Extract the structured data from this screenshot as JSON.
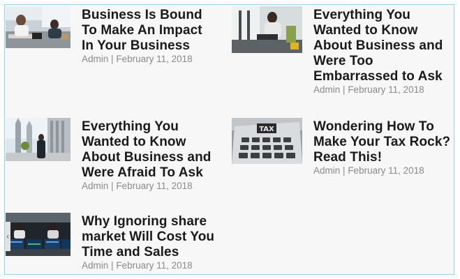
{
  "posts": [
    {
      "title": "Business Is Bound To Make An Impact In Your Business",
      "author": "Admin",
      "date": "February 11, 2018",
      "thumbnail": "office-workers-image"
    },
    {
      "title": "Everything You Wanted to Know About Business and Were Too Embarrassed to Ask",
      "author": "Admin",
      "date": "February 11, 2018",
      "thumbnail": "woman-at-laptop-image"
    },
    {
      "title": "Everything You Wanted to Know About Business and Were Afraid To Ask",
      "author": "Admin",
      "date": "February 11, 2018",
      "thumbnail": "businessman-city-image"
    },
    {
      "title": "Wondering How To Make Your Tax Rock? Read This!",
      "author": "Admin",
      "date": "February 11, 2018",
      "thumbnail": "tax-calculator-image"
    },
    {
      "title": "Why Ignoring share market Will Cost You Time and Sales",
      "author": "Admin",
      "date": "February 11, 2018",
      "thumbnail": "trading-floor-image"
    }
  ],
  "meta_separator": "|",
  "scroll_arrow": "‹",
  "colors": {
    "frame_border": "#8fd1ea",
    "background": "#f7f7f7",
    "title": "#1a1a1a",
    "meta": "#8a8a8a"
  }
}
